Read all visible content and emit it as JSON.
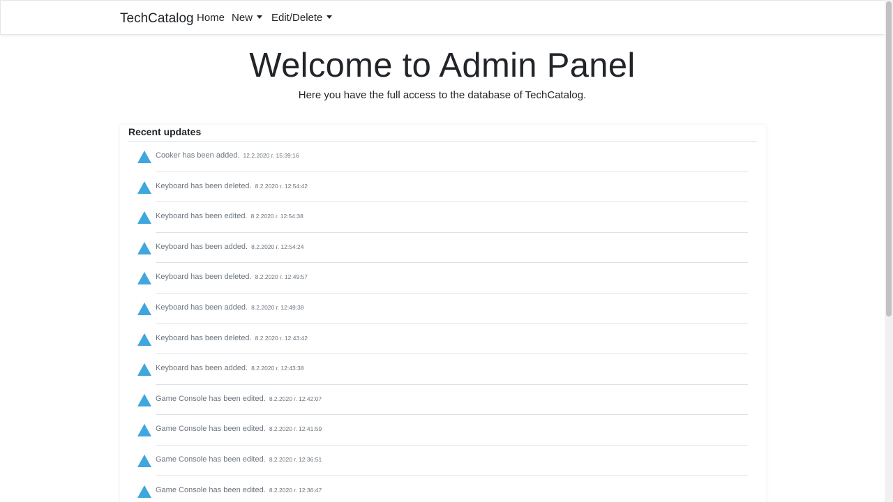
{
  "nav": {
    "brand": "TechCatalog",
    "home": "Home",
    "new": "New",
    "edit_delete": "Edit/Delete"
  },
  "hero": {
    "title": "Welcome to Admin Panel",
    "subtitle": "Here you have the full access to the database of TechCatalog."
  },
  "updates": {
    "title": "Recent updates",
    "items": [
      {
        "message": "Cooker has been added.",
        "timestamp": "12.2.2020 г. 15:39:16"
      },
      {
        "message": "Keyboard has been deleted.",
        "timestamp": "8.2.2020 г. 12:54:42"
      },
      {
        "message": "Keyboard has been edited.",
        "timestamp": "8.2.2020 г. 12:54:38"
      },
      {
        "message": "Keyboard has been added.",
        "timestamp": "8.2.2020 г. 12:54:24"
      },
      {
        "message": "Keyboard has been deleted.",
        "timestamp": "8.2.2020 г. 12:49:57"
      },
      {
        "message": "Keyboard has been added.",
        "timestamp": "8.2.2020 г. 12:49:38"
      },
      {
        "message": "Keyboard has been deleted.",
        "timestamp": "8.2.2020 г. 12:43:42"
      },
      {
        "message": "Keyboard has been added.",
        "timestamp": "8.2.2020 г. 12:43:38"
      },
      {
        "message": "Game Console has been edited.",
        "timestamp": "8.2.2020 г. 12:42:07"
      },
      {
        "message": "Game Console has been edited.",
        "timestamp": "8.2.2020 г. 12:41:59"
      },
      {
        "message": "Game Console has been edited.",
        "timestamp": "8.2.2020 г. 12:36:51"
      },
      {
        "message": "Game Console has been edited.",
        "timestamp": "8.2.2020 г. 12:36:47"
      }
    ]
  },
  "colors": {
    "accent": "#3fa6de",
    "muted_text": "#6c757d",
    "divider": "#dee2e6"
  },
  "icons": {
    "update_marker": "triangle-icon"
  }
}
